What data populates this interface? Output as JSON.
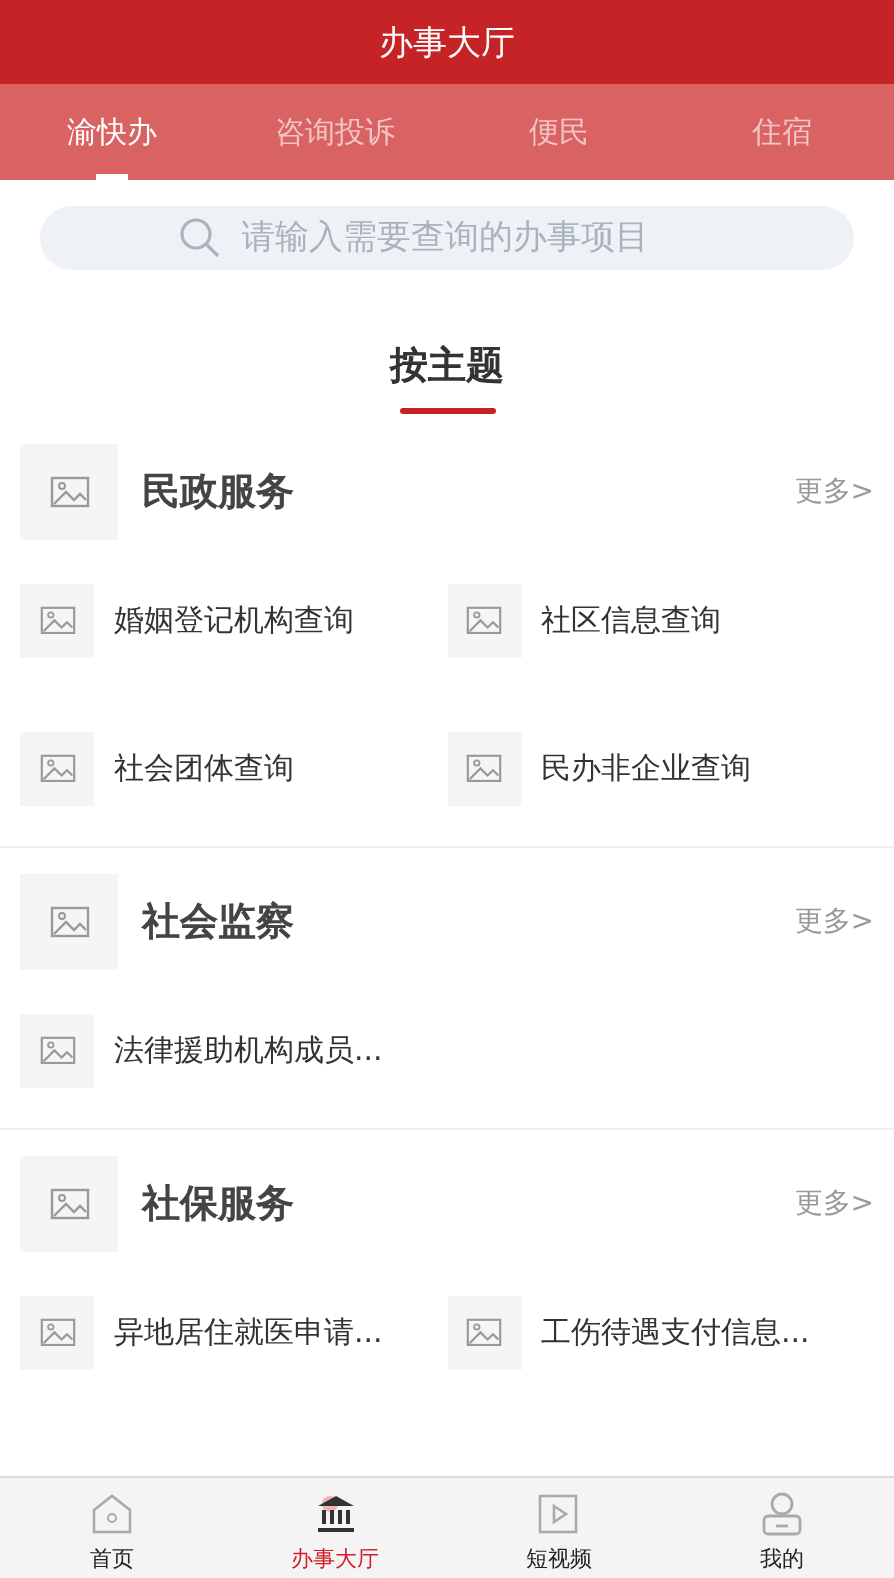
{
  "header": {
    "title": "办事大厅"
  },
  "tabs": [
    {
      "label": "渝快办",
      "selected": true
    },
    {
      "label": "咨询投诉",
      "selected": false
    },
    {
      "label": "便民",
      "selected": false
    },
    {
      "label": "住宿",
      "selected": false
    }
  ],
  "search": {
    "placeholder": "请输入需要查询的办事项目"
  },
  "section_heading": "按主题",
  "categories": [
    {
      "title": "民政服务",
      "more": "更多>",
      "items": [
        "婚姻登记机构查询",
        "社区信息查询",
        "社会团体查询",
        "民办非企业查询"
      ]
    },
    {
      "title": "社会监察",
      "more": "更多>",
      "items": [
        "法律援助机构成员..."
      ]
    },
    {
      "title": "社保服务",
      "more": "更多>",
      "items": [
        "异地居住就医申请...",
        "工伤待遇支付信息..."
      ]
    }
  ],
  "bottom_nav": [
    {
      "label": "首页",
      "kind": "home",
      "selected": false
    },
    {
      "label": "办事大厅",
      "kind": "hall",
      "selected": true
    },
    {
      "label": "短视频",
      "kind": "video",
      "selected": false
    },
    {
      "label": "我的",
      "kind": "profile",
      "selected": false
    }
  ]
}
